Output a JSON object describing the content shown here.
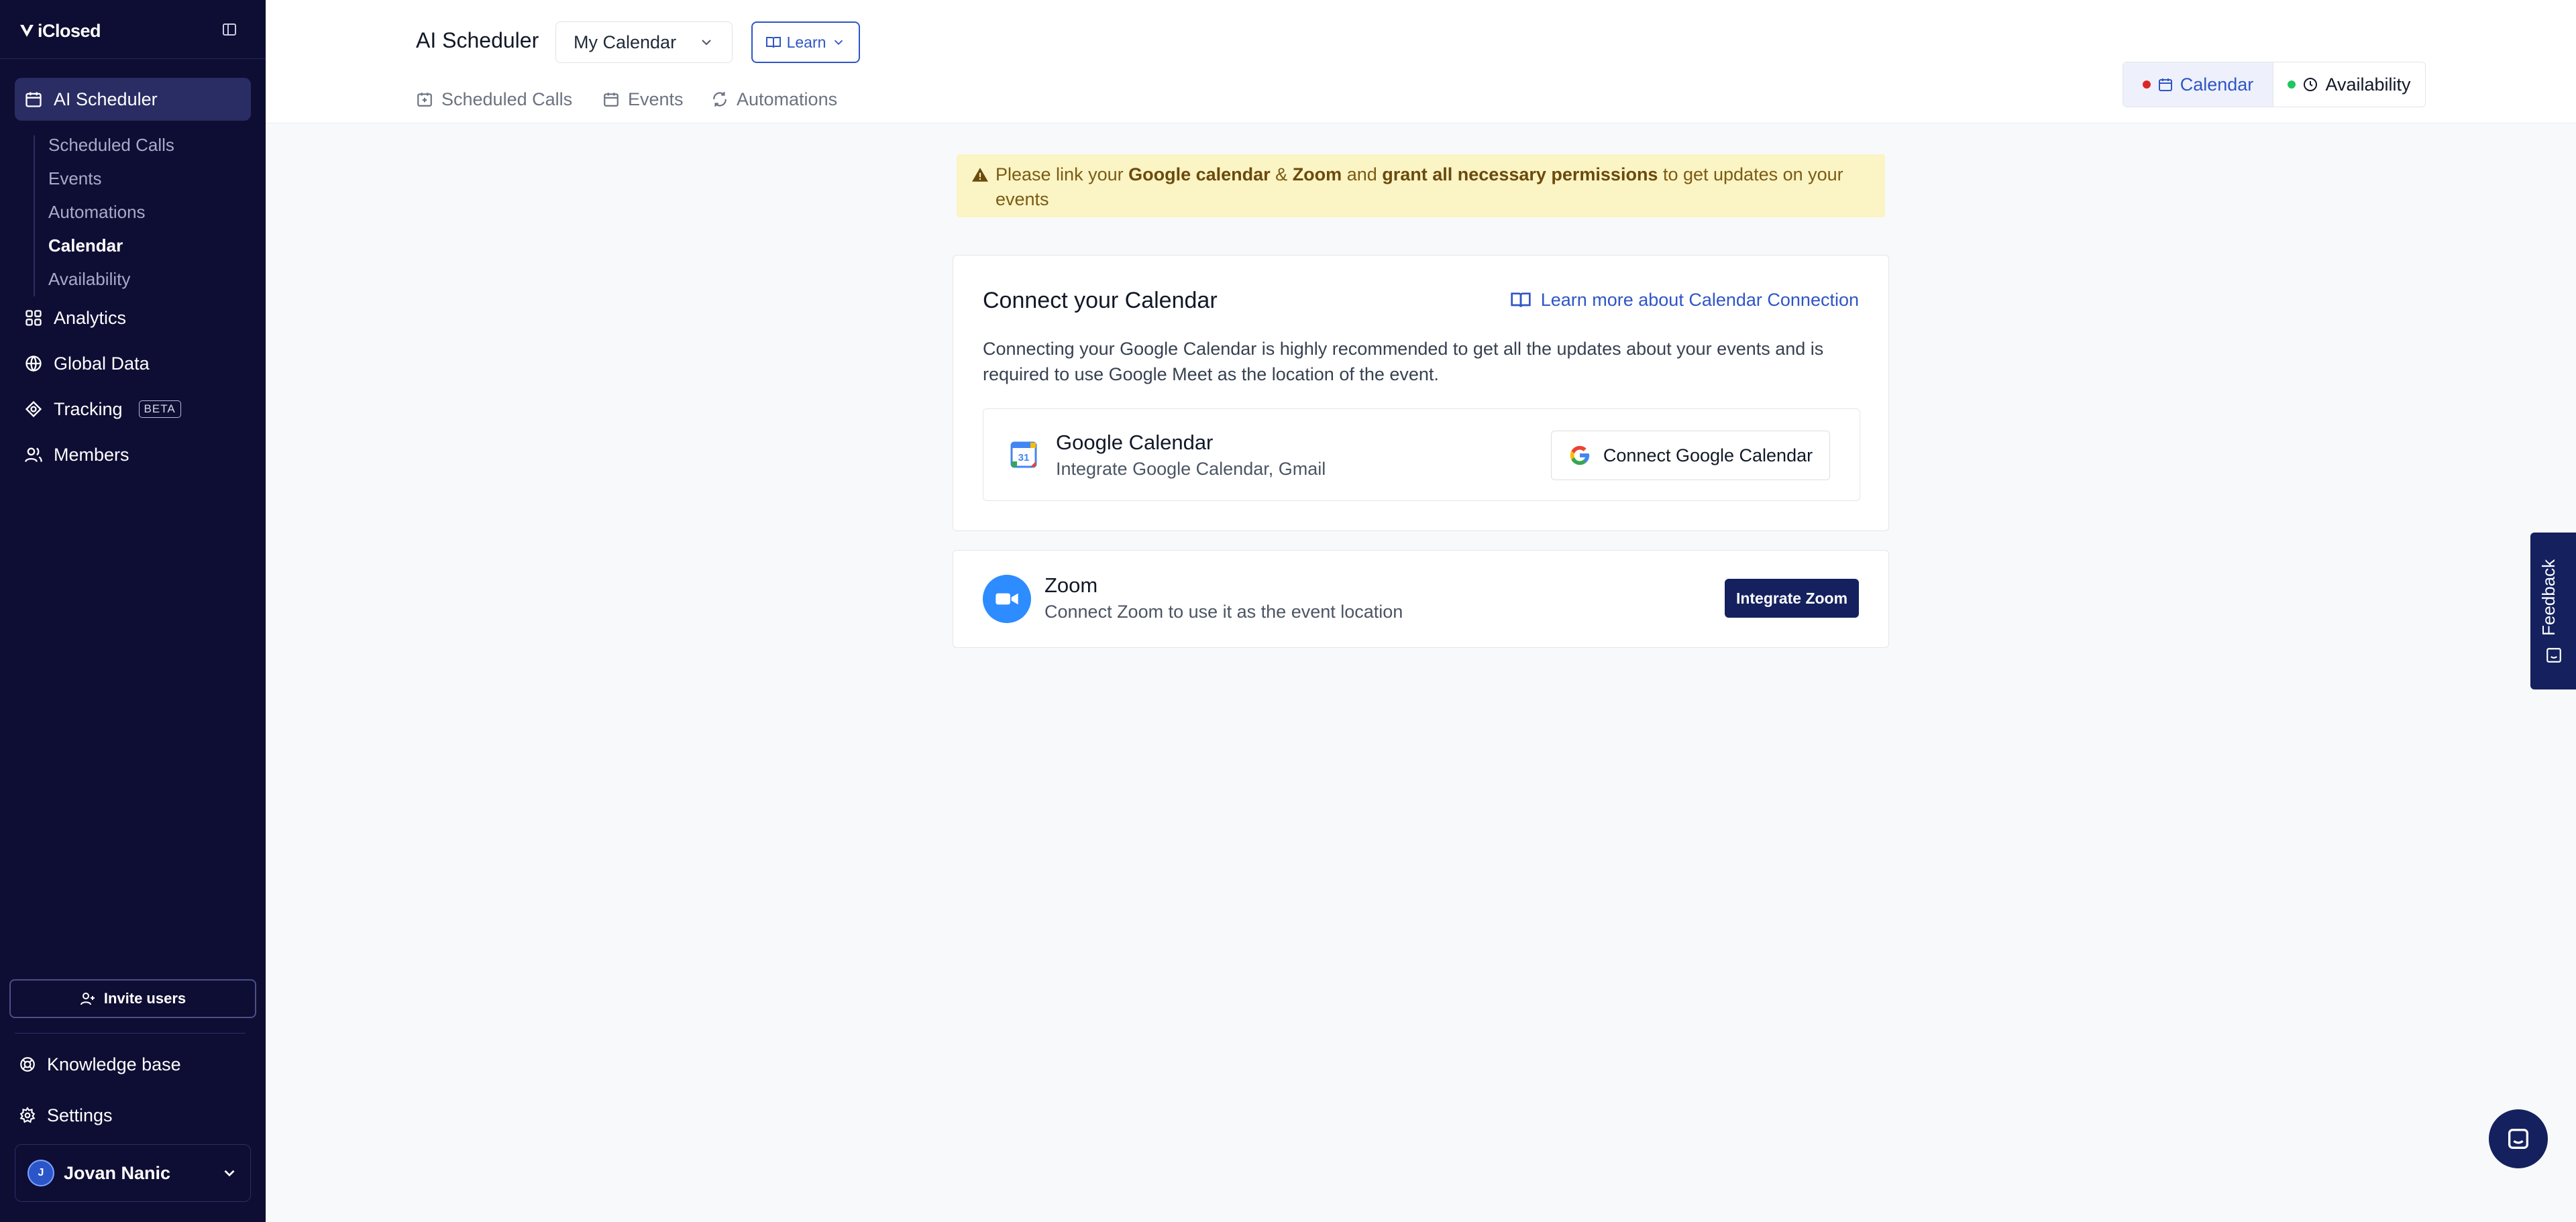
{
  "app": {
    "brand": "iClosed"
  },
  "sidebar": {
    "nav": [
      {
        "label": "AI Scheduler",
        "icon": "calendar-icon",
        "active": true
      },
      {
        "label": "Analytics",
        "icon": "grid-icon"
      },
      {
        "label": "Global Data",
        "icon": "globe-icon"
      },
      {
        "label": "Tracking",
        "icon": "target-icon",
        "badge": "BETA"
      },
      {
        "label": "Members",
        "icon": "users-icon"
      }
    ],
    "subnav": [
      {
        "label": "Scheduled Calls"
      },
      {
        "label": "Events"
      },
      {
        "label": "Automations"
      },
      {
        "label": "Calendar",
        "active": true
      },
      {
        "label": "Availability"
      }
    ],
    "invite_label": "Invite users",
    "footer": [
      {
        "label": "Knowledge base",
        "icon": "help-icon"
      },
      {
        "label": "Settings",
        "icon": "gear-icon"
      }
    ],
    "user": {
      "name": "Jovan Nanic",
      "initial": "J"
    }
  },
  "header": {
    "title": "AI Scheduler",
    "calendar_select": "My Calendar",
    "learn_label": "Learn",
    "tabs": [
      {
        "label": "Scheduled Calls",
        "icon": "calendar-check-icon"
      },
      {
        "label": "Events",
        "icon": "calendar-icon"
      },
      {
        "label": "Automations",
        "icon": "refresh-icon"
      }
    ],
    "view_toggle": [
      {
        "label": "Calendar",
        "dot_color": "#dc2626",
        "active": true
      },
      {
        "label": "Availability",
        "dot_color": "#22c55e"
      }
    ]
  },
  "warning": {
    "part1": "Please link your ",
    "bold1": "Google calendar",
    "amp": " & ",
    "bold2": "Zoom",
    "and": " and ",
    "bold3": "grant all necessary permissions",
    "part2": " to get updates on your events"
  },
  "calendar_card": {
    "title": "Connect your Calendar",
    "learn_link": "Learn more about Calendar Connection",
    "description": "Connecting your Google Calendar is highly recommended to get all the updates about your events and is required to use Google Meet as the location of the event.",
    "google": {
      "name": "Google Calendar",
      "subtitle": "Integrate Google Calendar, Gmail",
      "button": "Connect Google Calendar",
      "logo_text": "31"
    }
  },
  "zoom_card": {
    "name": "Zoom",
    "subtitle": "Connect Zoom to use it as the event location",
    "button": "Integrate Zoom"
  },
  "feedback_label": "Feedback",
  "colors": {
    "sidebar_bg": "#0e0d33",
    "accent": "#2f55c6",
    "primary_button": "#14215e",
    "warning_bg": "#fbf4c4"
  }
}
